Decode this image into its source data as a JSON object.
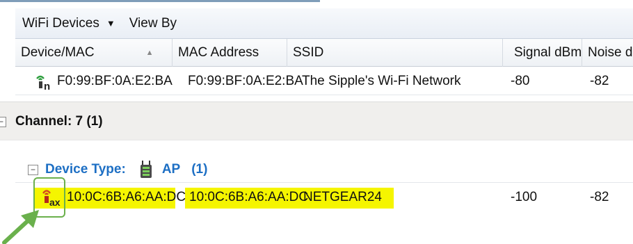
{
  "menubar": {
    "wifi_devices_label": "WiFi Devices",
    "wifi_devices_caret": "▼",
    "view_by_label": "View By"
  },
  "columns": {
    "device_mac": "Device/MAC",
    "mac_address": "MAC Address",
    "ssid": "SSID",
    "signal_dbm": "Signal dBm",
    "noise": "Noise dB"
  },
  "rows": [
    {
      "device": "F0:99:BF:0A:E2:BA",
      "mac": "F0:99:BF:0A:E2:BA",
      "ssid": "The Sipple's Wi-Fi Network",
      "signal": "-80",
      "noise": "-82",
      "icon_badge": "n"
    }
  ],
  "channel_group": {
    "expander": "−",
    "label": "Channel:  7 (1)"
  },
  "device_type_group": {
    "expander": "−",
    "label": "Device Type:",
    "type": "AP",
    "count": "(1)"
  },
  "highlighted_row": {
    "device": "10:0C:6B:A6:AA:DC",
    "mac": "10:0C:6B:A6:AA:DC",
    "ssid": "NETGEAR24",
    "signal": "-100",
    "noise": "-82",
    "icon_badge": "ax"
  },
  "colors": {
    "highlight": "#f5f500",
    "group_link": "#1d6fc4",
    "annotation_green": "#6ab04c"
  }
}
